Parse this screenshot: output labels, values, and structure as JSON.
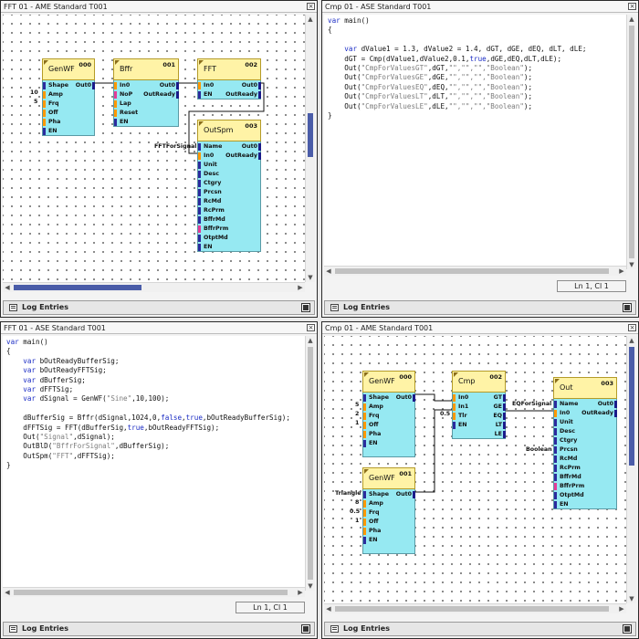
{
  "panes": {
    "tl": {
      "title": "FFT 01 - AME Standard T001",
      "log_label": "Log Entries"
    },
    "tr": {
      "title": "Cmp 01 - ASE Standard T001",
      "status": "Ln 1, Cl 1",
      "log_label": "Log Entries"
    },
    "bl": {
      "title": "FFT 01 - ASE Standard T001",
      "status": "Ln 1, Cl 1",
      "log_label": "Log Entries"
    },
    "br": {
      "title": "Cmp 01 - AME Standard T001",
      "log_label": "Log Entries"
    }
  },
  "tl_blocks": {
    "genwf": {
      "title": "GenWF",
      "num": "000",
      "ports": [
        "Shape",
        "Amp",
        "Frq",
        "Off",
        "Pha",
        "EN"
      ],
      "outs": [
        "Out0"
      ]
    },
    "bffr": {
      "title": "Bffr",
      "num": "001",
      "ports": [
        "In0",
        "NoP",
        "Lap",
        "Reset",
        "EN"
      ],
      "outs": [
        "Out0",
        "OutReady"
      ]
    },
    "fft": {
      "title": "FFT",
      "num": "002",
      "ports": [
        "In0",
        "EN"
      ],
      "outs": [
        "Out0",
        "OutReady"
      ]
    },
    "outspm": {
      "title": "OutSpm",
      "num": "003",
      "ports": [
        "Name",
        "In0",
        "Unit",
        "Desc",
        "Ctgry",
        "Prcsn",
        "RcMd",
        "RcPrm",
        "BffrMd",
        "BffrPrm",
        "OtptMd",
        "EN"
      ],
      "outs": [
        "Out0",
        "OutReady"
      ]
    },
    "ext_amp": "10",
    "ext_frq": "5",
    "ext_name": "FFTForSignal"
  },
  "br_blocks": {
    "genwf0": {
      "title": "GenWF",
      "num": "000",
      "ports": [
        "Shape",
        "Amp",
        "Frq",
        "Off",
        "Pha",
        "EN"
      ],
      "outs": [
        "Out0"
      ],
      "ext": [
        "5",
        "2",
        "1"
      ]
    },
    "genwf1": {
      "title": "GenWF",
      "num": "001",
      "ports": [
        "Shape",
        "Amp",
        "Frq",
        "Off",
        "Pha",
        "EN"
      ],
      "outs": [
        "Out0"
      ],
      "ext": [
        "Triangle",
        "8",
        "0.5",
        "1"
      ]
    },
    "cmp": {
      "title": "Cmp",
      "num": "002",
      "ports": [
        "In0",
        "In1",
        "Tlr",
        "EN"
      ],
      "outs": [
        "GT",
        "GE",
        "EQ",
        "LT",
        "LE"
      ],
      "ext": [
        "0.5"
      ]
    },
    "out": {
      "title": "Out",
      "num": "003",
      "ports": [
        "Name",
        "In0",
        "Unit",
        "Desc",
        "Ctgry",
        "Prcsn",
        "RcMd",
        "RcPrm",
        "BffrMd",
        "BffrPrm",
        "OtptMd",
        "EN"
      ],
      "outs": [
        "Out0",
        "OutReady"
      ]
    },
    "ext_name": "EQForSignal",
    "ext_unit": "Boolean"
  },
  "code_tr": [
    [
      {
        "t": "var",
        "c": "kw"
      },
      {
        "t": " main()"
      }
    ],
    [
      {
        "t": "{"
      }
    ],
    [
      {
        "t": ""
      }
    ],
    [
      {
        "t": "    "
      },
      {
        "t": "var",
        "c": "kw"
      },
      {
        "t": " dValue1 = 1.3, dValue2 = 1.4, dGT, dGE, dEQ, dLT, dLE;"
      }
    ],
    [
      {
        "t": "    dGT = Cmp(dValue1,dValue2,0.1,"
      },
      {
        "t": "true",
        "c": "kw"
      },
      {
        "t": ",dGE,dEQ,dLT,dLE);"
      }
    ],
    [
      {
        "t": "    Out("
      },
      {
        "t": "\"CmpForValuesGT\"",
        "c": "str"
      },
      {
        "t": ",dGT,"
      },
      {
        "t": "\"\",\"\",\"\",\"Boolean\"",
        "c": "str"
      },
      {
        "t": ");"
      }
    ],
    [
      {
        "t": "    Out("
      },
      {
        "t": "\"CmpForValuesGE\"",
        "c": "str"
      },
      {
        "t": ",dGE,"
      },
      {
        "t": "\"\",\"\",\"\",\"Boolean\"",
        "c": "str"
      },
      {
        "t": ");"
      }
    ],
    [
      {
        "t": "    Out("
      },
      {
        "t": "\"CmpForValuesEQ\"",
        "c": "str"
      },
      {
        "t": ",dEQ,"
      },
      {
        "t": "\"\",\"\",\"\",\"Boolean\"",
        "c": "str"
      },
      {
        "t": ");"
      }
    ],
    [
      {
        "t": "    Out("
      },
      {
        "t": "\"CmpForValuesLT\"",
        "c": "str"
      },
      {
        "t": ",dLT,"
      },
      {
        "t": "\"\",\"\",\"\",\"Boolean\"",
        "c": "str"
      },
      {
        "t": ");"
      }
    ],
    [
      {
        "t": "    Out("
      },
      {
        "t": "\"CmpForValuesLE\"",
        "c": "str"
      },
      {
        "t": ",dLE,"
      },
      {
        "t": "\"\",\"\",\"\",\"Boolean\"",
        "c": "str"
      },
      {
        "t": ");"
      }
    ],
    [
      {
        "t": "}"
      }
    ]
  ],
  "code_bl": [
    [
      {
        "t": "var",
        "c": "kw"
      },
      {
        "t": " main()"
      }
    ],
    [
      {
        "t": "{"
      }
    ],
    [
      {
        "t": "    "
      },
      {
        "t": "var",
        "c": "kw"
      },
      {
        "t": " bOutReadyBufferSig;"
      }
    ],
    [
      {
        "t": "    "
      },
      {
        "t": "var",
        "c": "kw"
      },
      {
        "t": " bOutReadyFFTSig;"
      }
    ],
    [
      {
        "t": "    "
      },
      {
        "t": "var",
        "c": "kw"
      },
      {
        "t": " dBufferSig;"
      }
    ],
    [
      {
        "t": "    "
      },
      {
        "t": "var",
        "c": "kw"
      },
      {
        "t": " dFFTSig;"
      }
    ],
    [
      {
        "t": "    "
      },
      {
        "t": "var",
        "c": "kw"
      },
      {
        "t": " dSignal = GenWF("
      },
      {
        "t": "\"Sine\"",
        "c": "str"
      },
      {
        "t": ",10,100);"
      }
    ],
    [
      {
        "t": ""
      }
    ],
    [
      {
        "t": "    dBufferSig = Bffr(dSignal,1024,0,"
      },
      {
        "t": "false",
        "c": "kw"
      },
      {
        "t": ","
      },
      {
        "t": "true",
        "c": "kw"
      },
      {
        "t": ",bOutReadyBufferSig);"
      }
    ],
    [
      {
        "t": "    dFFTSig = FFT(dBufferSig,"
      },
      {
        "t": "true",
        "c": "kw"
      },
      {
        "t": ",bOutReadyFFTSig);"
      }
    ],
    [
      {
        "t": "    Out("
      },
      {
        "t": "\"Signal\"",
        "c": "str"
      },
      {
        "t": ",dSignal);"
      }
    ],
    [
      {
        "t": "    OutBlD("
      },
      {
        "t": "\"BffrForSignal\"",
        "c": "str"
      },
      {
        "t": ",dBufferSig);"
      }
    ],
    [
      {
        "t": "    OutSpm("
      },
      {
        "t": "\"FFT\"",
        "c": "str"
      },
      {
        "t": ",dFFTSig);"
      }
    ],
    [
      {
        "t": "}"
      }
    ]
  ]
}
